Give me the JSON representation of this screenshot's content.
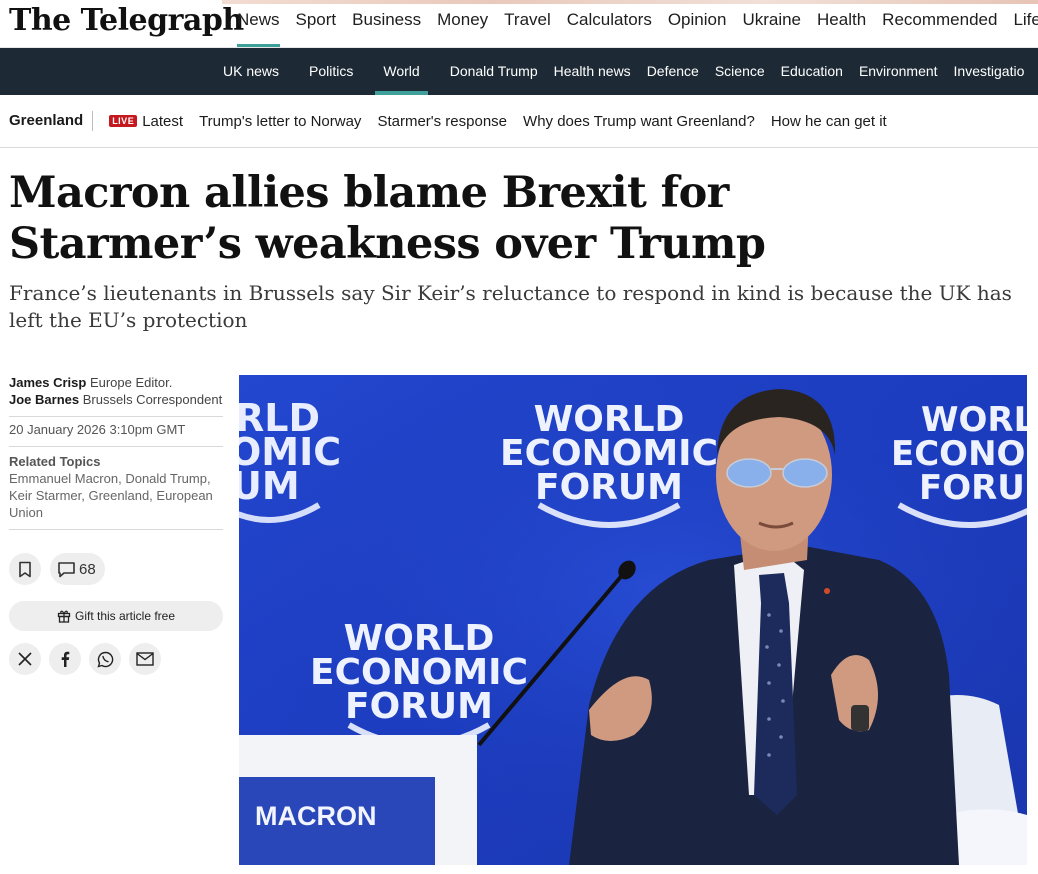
{
  "brand": {
    "logo_text": "The Telegraph"
  },
  "primary_nav": {
    "items": [
      "News",
      "Sport",
      "Business",
      "Money",
      "Travel",
      "Calculators",
      "Opinion",
      "Ukraine",
      "Health",
      "Recommended",
      "Lifest"
    ],
    "active": "News"
  },
  "secondary_nav": {
    "items": [
      "UK news",
      "Politics",
      "World",
      "Donald Trump",
      "Health news",
      "Defence",
      "Science",
      "Education",
      "Environment",
      "Investigatio"
    ],
    "active": "World"
  },
  "topic_bar": {
    "title": "Greenland",
    "live_badge": "LIVE",
    "links": [
      "Latest",
      "Trump's letter to Norway",
      "Starmer's response",
      "Why does Trump want Greenland?",
      "How he can get it"
    ]
  },
  "article": {
    "headline": "Macron allies blame Brexit for Starmer’s weakness over Trump",
    "standfirst": "France’s lieutenants in Brussels say Sir Keir’s reluctance to respond in kind is because the UK has left the EU’s protection",
    "authors": [
      {
        "name": "James Crisp",
        "role": "Europe Editor."
      },
      {
        "name": "Joe Barnes",
        "role": "Brussels Correspondent"
      }
    ],
    "dateline": "20 January 2026 3:10pm GMT",
    "related_topics_heading": "Related Topics",
    "related_topics": "Emmanuel Macron, Donald Trump, Keir Starmer, Greenland, European Union",
    "comment_count": "68",
    "gift_label": "Gift this article free"
  },
  "hero_image": {
    "backdrop_text": "WORLD ECONOMIC FORUM",
    "backdrop_lines": [
      "WORLD",
      "ECONOMIC",
      "FORUM"
    ],
    "partial_lines": [
      "RLD",
      "OMIC",
      "UM"
    ],
    "right_lines": [
      "WORLD",
      "ECONOMIC",
      "FORU"
    ],
    "nameplate": "MACRON"
  },
  "colors": {
    "accent": "#3f9f9a",
    "dark_nav": "#1d2a35",
    "live_red": "#c4191f",
    "hero_blue": "#1f3fc4"
  },
  "icons": [
    "bookmark-icon",
    "comment-icon",
    "gift-icon",
    "x-icon",
    "facebook-icon",
    "whatsapp-icon",
    "email-icon"
  ]
}
